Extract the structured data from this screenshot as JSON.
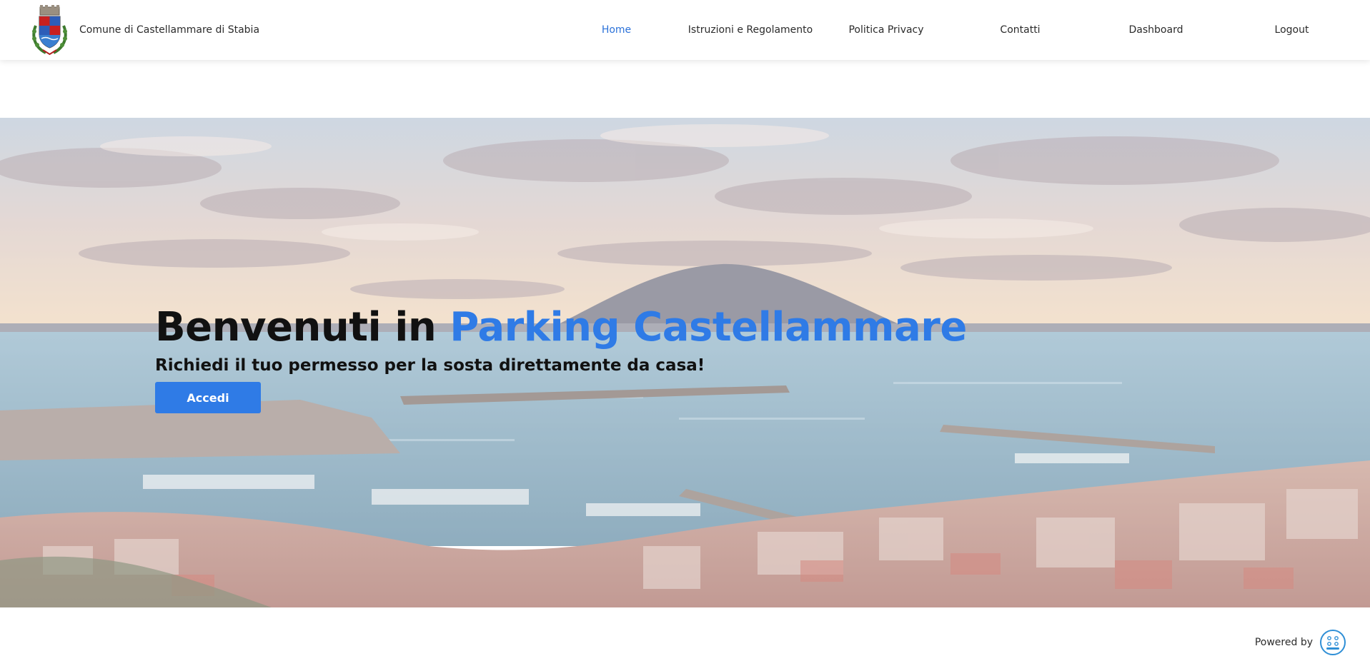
{
  "header": {
    "brand_name": "Comune di Castellammare di Stabia",
    "logo_icon": "coat-of-arms-icon",
    "nav": [
      {
        "label": "Home",
        "active": true
      },
      {
        "label": "Istruzioni e Regolamento",
        "active": false
      },
      {
        "label": "Politica Privacy",
        "active": false
      },
      {
        "label": "Contatti",
        "active": false
      },
      {
        "label": "Dashboard",
        "active": false
      },
      {
        "label": "Logout",
        "active": false
      }
    ]
  },
  "hero": {
    "title_prefix": "Benvenuti in ",
    "title_accent": "Parking Castellammare",
    "subtitle": "Richiedi il tuo permesso per la sosta direttamente da casa!",
    "button_label": "Accedi",
    "background": "harbor-panorama-image"
  },
  "footer": {
    "powered_label": "Powered by",
    "provider_logo_icon": "provider-logo-icon"
  },
  "colors": {
    "accent": "#2f7be6",
    "nav_active": "#2c72d9",
    "text": "#2b2b2b",
    "title_text": "#111111"
  }
}
